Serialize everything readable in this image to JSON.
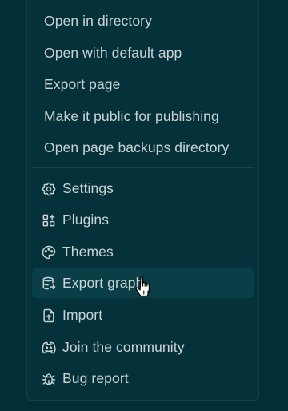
{
  "menu": {
    "top_items": [
      {
        "label": "Open in directory"
      },
      {
        "label": "Open with default app"
      },
      {
        "label": "Export page"
      },
      {
        "label": "Make it public for publishing"
      },
      {
        "label": "Open page backups directory"
      }
    ],
    "bottom_items": [
      {
        "label": "Settings",
        "icon": "settings-gear-icon"
      },
      {
        "label": "Plugins",
        "icon": "plugins-grid-icon"
      },
      {
        "label": "Themes",
        "icon": "palette-icon"
      },
      {
        "label": "Export graph",
        "icon": "database-export-icon",
        "hovered": true
      },
      {
        "label": "Import",
        "icon": "file-upload-icon"
      },
      {
        "label": "Join the community",
        "icon": "discord-icon"
      },
      {
        "label": "Bug report",
        "icon": "bug-icon"
      }
    ]
  },
  "colors": {
    "background": "#042e37",
    "menu_background": "#05313a",
    "hover_background": "#0a3f48",
    "text": "#c9d3d6"
  }
}
